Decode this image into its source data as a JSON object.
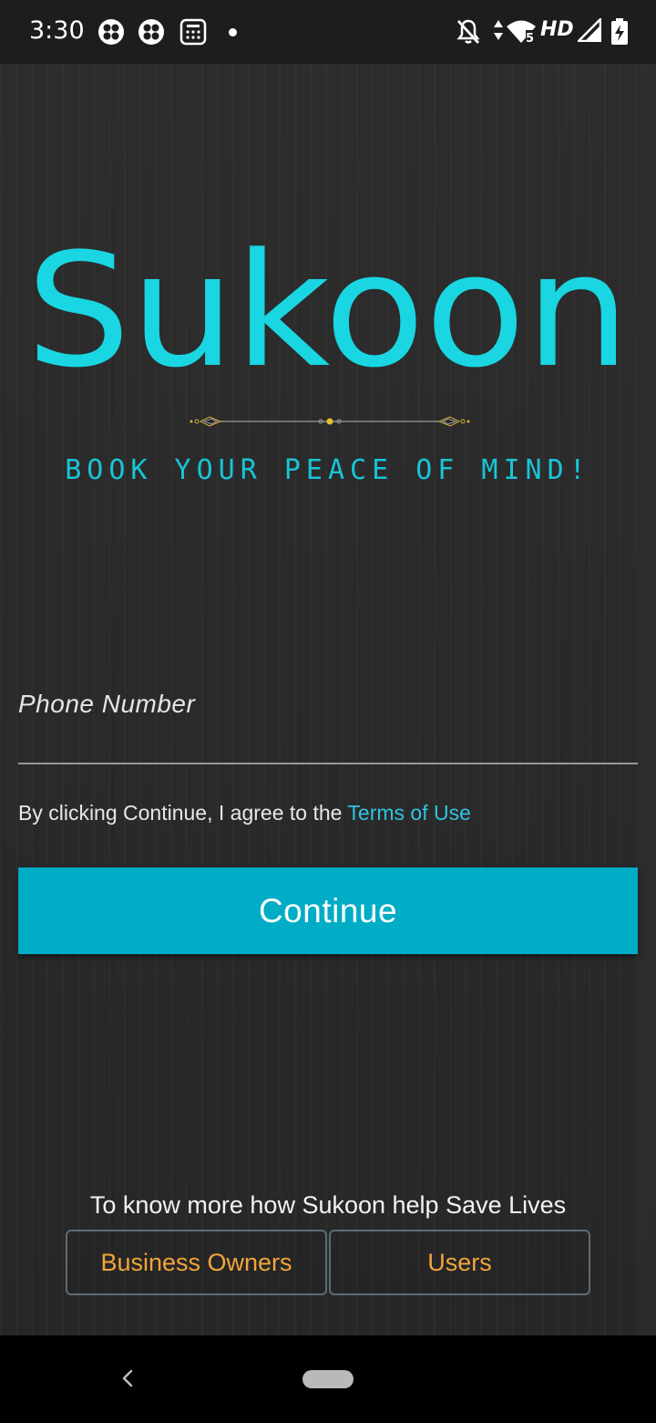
{
  "status_bar": {
    "time": "3:30",
    "network_label": "HD",
    "left_icons": [
      "app-notification-icon",
      "app-notification-icon",
      "calculator-icon",
      "dot-indicator"
    ],
    "right_icons": [
      "bell-off-icon",
      "data-arrows-icon",
      "wifi-icon",
      "signal-icon",
      "battery-charging-icon"
    ]
  },
  "app": {
    "logo": "Sukoon",
    "tagline": "BOOK YOUR PEACE OF MIND!",
    "phone_field": {
      "placeholder": "Phone Number",
      "value": ""
    },
    "terms": {
      "prefix": "By clicking Continue, I agree to the ",
      "link": "Terms of Use"
    },
    "continue_label": "Continue",
    "more_info_text": "To know more how Sukoon help Save Lives",
    "business_owners_label": "Business Owners",
    "users_label": "Users"
  },
  "colors": {
    "brand_cyan": "#19d6e2",
    "button_teal": "#00acc6",
    "link_blue": "#2ec4e0",
    "accent_orange": "#f2a63a",
    "background": "#2a2a2a"
  },
  "nav_bar": {
    "icons": [
      "back-icon",
      "home-pill-icon"
    ]
  }
}
